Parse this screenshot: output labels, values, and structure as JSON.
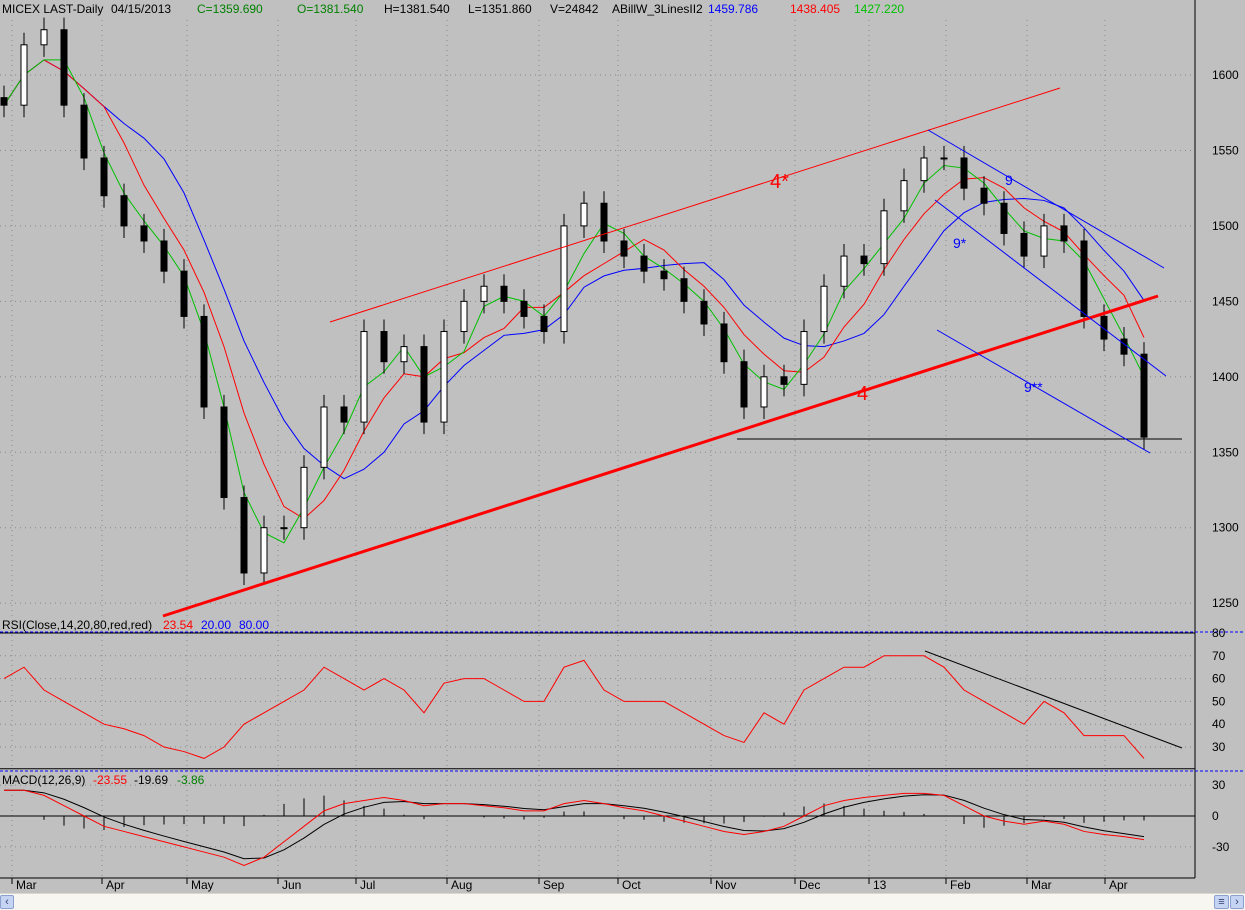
{
  "header": {
    "symbol": "MICEX LAST-Daily",
    "date": "04/15/2013",
    "close": "C=1359.690",
    "open": "O=1381.540",
    "high": "H=1381.540",
    "low": "L=1351.860",
    "volume": "V=24842",
    "indicator": "ABillW_3LinesII2",
    "line_blue": "1459.786",
    "line_red": "1438.405",
    "line_green": "1427.220"
  },
  "rsi_header": {
    "label": "RSI(Close,14,20,80,red,red)",
    "value": "23.54",
    "low": "20.00",
    "high": "80.00"
  },
  "macd_header": {
    "label": "MACD(12,26,9)",
    "macd": "-23.55",
    "signal": "-19.69",
    "hist": "-3.86"
  },
  "annotations": {
    "channel_upper": "4*",
    "channel_lower": "4",
    "down_upper": "9",
    "down_mid": "9*",
    "down_lower": "9**"
  },
  "colors": {
    "bg": "#c0c0c0",
    "green": "#00c000",
    "red": "#ff0000",
    "blue": "#0000ff"
  },
  "chart_data": {
    "type": "line",
    "title": "MICEX LAST-Daily",
    "x_ticks": [
      "Mar",
      "Apr",
      "May",
      "Jun",
      "Jul",
      "Aug",
      "Sep",
      "Oct",
      "Nov",
      "Dec",
      "13",
      "Feb",
      "Mar",
      "Apr"
    ],
    "price": {
      "y_ticks": [
        1600,
        1550,
        1500,
        1450,
        1400,
        1350,
        1300,
        1250
      ],
      "ylim": [
        1225,
        1650
      ],
      "closes": [
        1580,
        1620,
        1630,
        1580,
        1545,
        1520,
        1500,
        1490,
        1470,
        1440,
        1380,
        1320,
        1270,
        1300,
        1300,
        1340,
        1380,
        1370,
        1430,
        1410,
        1420,
        1370,
        1430,
        1450,
        1460,
        1450,
        1440,
        1430,
        1500,
        1515,
        1490,
        1480,
        1470,
        1465,
        1450,
        1435,
        1410,
        1380,
        1400,
        1395,
        1430,
        1460,
        1480,
        1475,
        1510,
        1530,
        1545,
        1545,
        1525,
        1515,
        1495,
        1480,
        1500,
        1490,
        1440,
        1425,
        1415,
        1360
      ],
      "support_level": 1360
    },
    "rsi": {
      "y_ticks": [
        80,
        70,
        60,
        50,
        40,
        30
      ],
      "ylim": [
        20,
        80
      ],
      "values": [
        60,
        65,
        55,
        50,
        45,
        40,
        38,
        35,
        30,
        28,
        25,
        30,
        40,
        45,
        50,
        55,
        65,
        60,
        55,
        60,
        55,
        45,
        58,
        60,
        60,
        55,
        50,
        50,
        65,
        68,
        55,
        50,
        50,
        50,
        45,
        40,
        35,
        32,
        45,
        40,
        55,
        60,
        65,
        65,
        70,
        70,
        70,
        65,
        55,
        50,
        45,
        40,
        50,
        45,
        35,
        35,
        35,
        25
      ]
    },
    "macd": {
      "y_ticks": [
        30,
        0,
        -30
      ],
      "ylim": [
        -40,
        35
      ],
      "values": [
        25,
        25,
        20,
        10,
        0,
        -10,
        -15,
        -20,
        -25,
        -30,
        -35,
        -40,
        -48,
        -40,
        -25,
        -10,
        5,
        12,
        15,
        18,
        15,
        10,
        12,
        12,
        10,
        8,
        5,
        5,
        12,
        15,
        12,
        8,
        5,
        0,
        -5,
        -10,
        -15,
        -18,
        -15,
        -10,
        0,
        10,
        15,
        18,
        20,
        22,
        22,
        20,
        10,
        0,
        -5,
        -8,
        -5,
        -8,
        -15,
        -18,
        -20,
        -23
      ]
    }
  }
}
